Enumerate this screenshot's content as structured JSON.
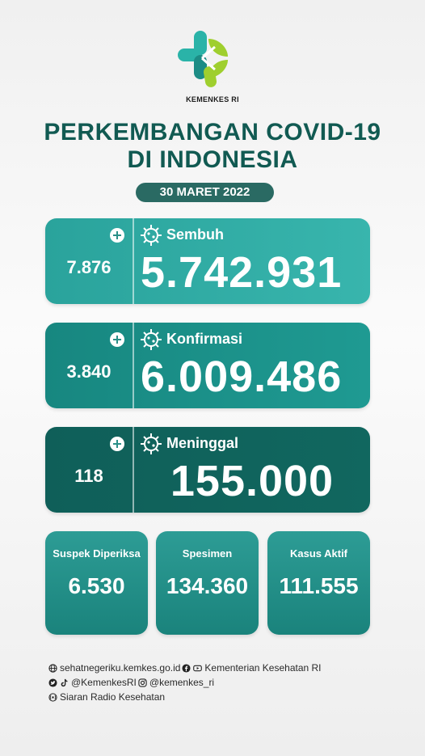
{
  "logo": {
    "text": "KEMENKES RI",
    "colors": [
      "#2ab3a8",
      "#9fcf2e",
      "#1c8c85"
    ]
  },
  "title": {
    "line1": "PERKEMBANGAN COVID-19",
    "line2": "DI INDONESIA"
  },
  "date": "30 MARET 2022",
  "cards": [
    {
      "label": "Sembuh",
      "increase": "7.876",
      "total": "5.742.931",
      "icon": "virus-icon"
    },
    {
      "label": "Konfirmasi",
      "increase": "3.840",
      "total": "6.009.486",
      "icon": "virus-icon"
    },
    {
      "label": "Meninggal",
      "increase": "118",
      "total": "155.000",
      "icon": "virus-icon"
    }
  ],
  "stats": [
    {
      "label": "Suspek Diperiksa",
      "value": "6.530"
    },
    {
      "label": "Spesimen",
      "value": "134.360"
    },
    {
      "label": "Kasus Aktif",
      "value": "111.555"
    }
  ],
  "footer": {
    "website": "sehatnegeriku.kemkes.go.id",
    "facebook_youtube": "Kementerian Kesehatan RI",
    "twitter_tiktok": "@KemenkesRI",
    "instagram": "@kemenkes_ri",
    "radio": "Siaran Radio Kesehatan"
  },
  "colors": {
    "title": "#115a52",
    "card1": "#2aa39c",
    "card2": "#178780",
    "card3": "#0f5f59"
  }
}
